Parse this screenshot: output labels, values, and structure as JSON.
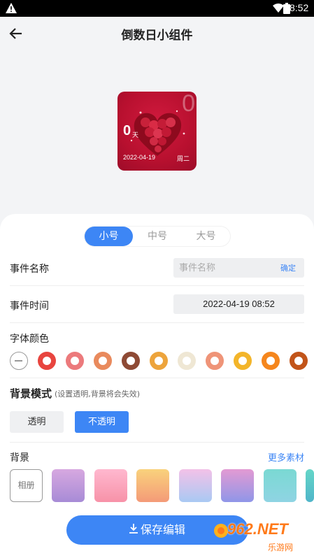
{
  "status_bar": {
    "time": "8:52"
  },
  "header": {
    "title": "倒数日小组件"
  },
  "widget": {
    "corner_digit": "0",
    "days": "0",
    "unit": "天",
    "date": "2022-04-19",
    "weekday": "周二",
    "background_color": "#c0143a"
  },
  "size_tabs": [
    {
      "label": "小号",
      "active": true
    },
    {
      "label": "中号",
      "active": false
    },
    {
      "label": "大号",
      "active": false
    }
  ],
  "event_name": {
    "label": "事件名称",
    "placeholder": "事件名称",
    "value": "",
    "confirm": "确定"
  },
  "event_time": {
    "label": "事件时间",
    "value": "2022-04-19 08:52"
  },
  "font_color": {
    "label": "字体颜色",
    "colors": [
      "#e8453f",
      "#ec7a7c",
      "#e98a5d",
      "#8e4a35",
      "#eda43c",
      "#efe7d4",
      "#ef9478",
      "#f3b52a",
      "#f5861d",
      "#c25419"
    ]
  },
  "background_mode": {
    "label": "背景模式",
    "hint": "(设置透明,背景将会失效)",
    "options": [
      {
        "label": "透明",
        "active": false
      },
      {
        "label": "不透明",
        "active": true
      }
    ]
  },
  "background": {
    "label": "背景",
    "more": "更多素材",
    "album": "相册",
    "tiles": [
      [
        "#d7a8e0",
        "#a78bd6"
      ],
      [
        "#ffb8cf",
        "#f792a8"
      ],
      [
        "#f9d27c",
        "#f49a78"
      ],
      [
        "#f3c1e8",
        "#a9c9f3"
      ],
      [
        "#e39ad3",
        "#8f96e8"
      ],
      [
        "#7ad9d3",
        "#8fd4e3"
      ],
      [
        "#65d6c8",
        "#4fb5c9"
      ]
    ]
  },
  "save_button": {
    "label": "保存编辑"
  },
  "watermark": {
    "main": "962.NET",
    "sub": "乐游网"
  },
  "accent_color": "#3d86f5"
}
